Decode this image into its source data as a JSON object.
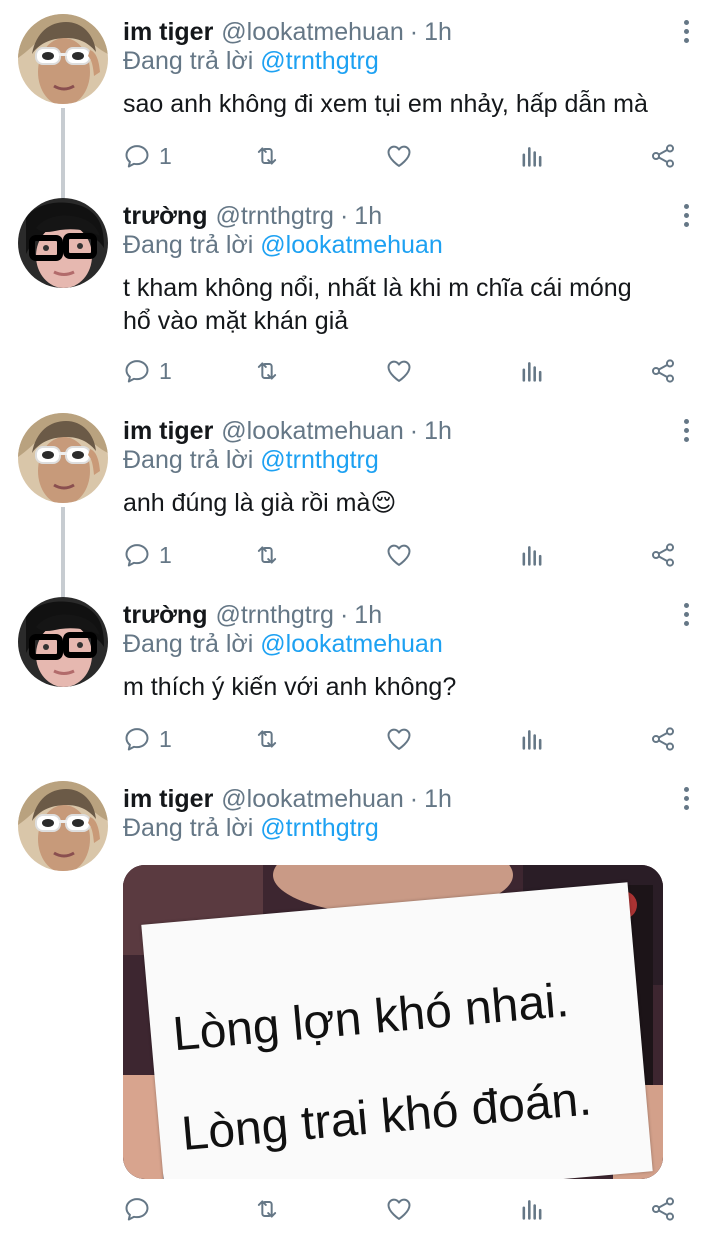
{
  "tweets": [
    {
      "name": "im tiger",
      "handle": "@lookatmehuan",
      "separator": "·",
      "time": "1h",
      "reply_prefix": "Đang trả lời",
      "reply_to": "@trnthgtrg",
      "text": "sao anh không đi xem tụi em nhảy, hấp dẫn mà",
      "reply_count": "1",
      "avatar": "avatar-im-tiger"
    },
    {
      "name": "trường",
      "handle": "@trnthgtrg",
      "separator": "·",
      "time": "1h",
      "reply_prefix": "Đang trả lời",
      "reply_to": "@lookatmehuan",
      "text_lines": [
        "t kham không nổi, nhất là khi m chĩa cái móng",
        "hổ vào mặt khán giả"
      ],
      "reply_count": "1",
      "avatar": "avatar-truong"
    },
    {
      "name": "im tiger",
      "handle": "@lookatmehuan",
      "separator": "·",
      "time": "1h",
      "reply_prefix": "Đang trả lời",
      "reply_to": "@trnthgtrg",
      "text": "anh đúng là già rồi mà😌",
      "reply_count": "1",
      "avatar": "avatar-im-tiger"
    },
    {
      "name": "trường",
      "handle": "@trnthgtrg",
      "separator": "·",
      "time": "1h",
      "reply_prefix": "Đang trả lời",
      "reply_to": "@lookatmehuan",
      "text": "m thích ý kiến với anh không?",
      "reply_count": "1",
      "avatar": "avatar-truong"
    },
    {
      "name": "im tiger",
      "handle": "@lookatmehuan",
      "separator": "·",
      "time": "1h",
      "reply_prefix": "Đang trả lời",
      "reply_to": "@trnthgtrg",
      "media_sign_lines": [
        "Lòng lợn khó nhai.",
        "Lòng trai khó đoán."
      ],
      "reply_count": "",
      "avatar": "avatar-im-tiger"
    }
  ],
  "icons": {
    "reply": "reply-icon",
    "retweet": "retweet-icon",
    "like": "heart-icon",
    "analytics": "analytics-icon",
    "share": "share-icon",
    "more": "more-vertical-icon"
  },
  "colors": {
    "text": "#14171a",
    "secondary": "#657786",
    "link": "#1da1f2",
    "thread_line": "#c7ccd1"
  }
}
